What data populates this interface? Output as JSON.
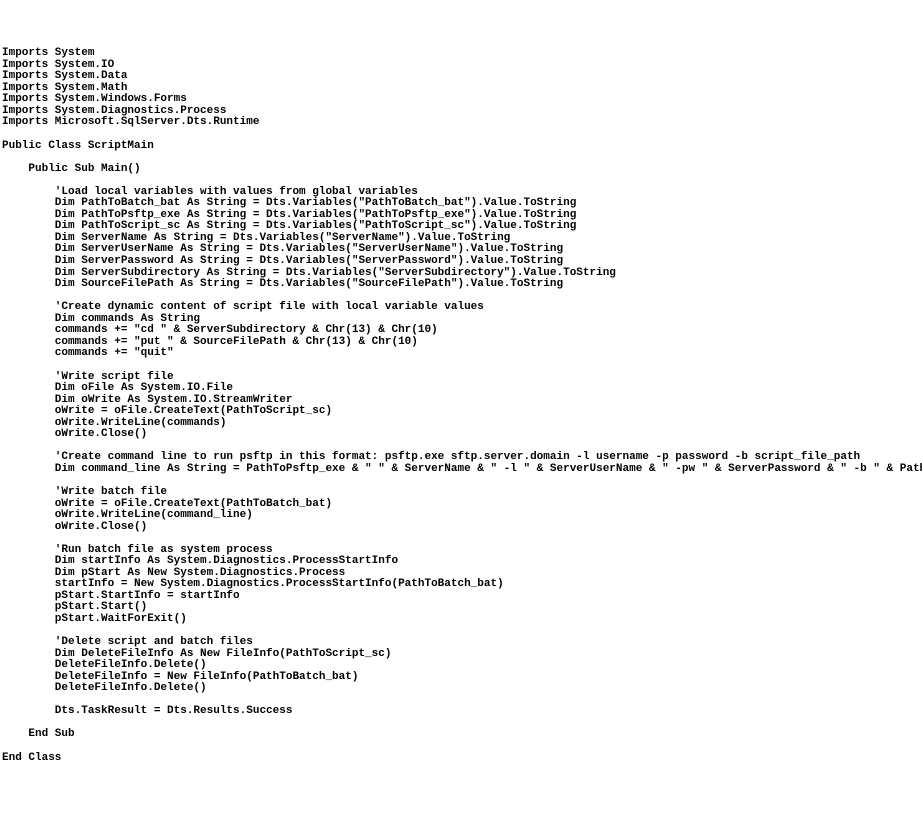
{
  "lines": [
    "Imports System",
    "Imports System.IO",
    "Imports System.Data",
    "Imports System.Math",
    "Imports System.Windows.Forms",
    "Imports System.Diagnostics.Process",
    "Imports Microsoft.SqlServer.Dts.Runtime",
    "",
    "Public Class ScriptMain",
    "",
    "    Public Sub Main()",
    "",
    "        'Load local variables with values from global variables",
    "        Dim PathToBatch_bat As String = Dts.Variables(\"PathToBatch_bat\").Value.ToString",
    "        Dim PathToPsftp_exe As String = Dts.Variables(\"PathToPsftp_exe\").Value.ToString",
    "        Dim PathToScript_sc As String = Dts.Variables(\"PathToScript_sc\").Value.ToString",
    "        Dim ServerName As String = Dts.Variables(\"ServerName\").Value.ToString",
    "        Dim ServerUserName As String = Dts.Variables(\"ServerUserName\").Value.ToString",
    "        Dim ServerPassword As String = Dts.Variables(\"ServerPassword\").Value.ToString",
    "        Dim ServerSubdirectory As String = Dts.Variables(\"ServerSubdirectory\").Value.ToString",
    "        Dim SourceFilePath As String = Dts.Variables(\"SourceFilePath\").Value.ToString",
    "",
    "        'Create dynamic content of script file with local variable values",
    "        Dim commands As String",
    "        commands += \"cd \" & ServerSubdirectory & Chr(13) & Chr(10)",
    "        commands += \"put \" & SourceFilePath & Chr(13) & Chr(10)",
    "        commands += \"quit\"",
    "",
    "        'Write script file",
    "        Dim oFile As System.IO.File",
    "        Dim oWrite As System.IO.StreamWriter",
    "        oWrite = oFile.CreateText(PathToScript_sc)",
    "        oWrite.WriteLine(commands)",
    "        oWrite.Close()",
    "",
    "        'Create command line to run psftp in this format: psftp.exe sftp.server.domain -l username -p password -b script_file_path",
    "        Dim command_line As String = PathToPsftp_exe & \" \" & ServerName & \" -l \" & ServerUserName & \" -pw \" & ServerPassword & \" -b \" & PathToScript_sc",
    "",
    "        'Write batch file",
    "        oWrite = oFile.CreateText(PathToBatch_bat)",
    "        oWrite.WriteLine(command_line)",
    "        oWrite.Close()",
    "",
    "        'Run batch file as system process",
    "        Dim startInfo As System.Diagnostics.ProcessStartInfo",
    "        Dim pStart As New System.Diagnostics.Process",
    "        startInfo = New System.Diagnostics.ProcessStartInfo(PathToBatch_bat)",
    "        pStart.StartInfo = startInfo",
    "        pStart.Start()",
    "        pStart.WaitForExit()",
    "",
    "        'Delete script and batch files",
    "        Dim DeleteFileInfo As New FileInfo(PathToScript_sc)",
    "        DeleteFileInfo.Delete()",
    "        DeleteFileInfo = New FileInfo(PathToBatch_bat)",
    "        DeleteFileInfo.Delete()",
    "",
    "        Dts.TaskResult = Dts.Results.Success",
    "",
    "    End Sub",
    "",
    "End Class"
  ]
}
